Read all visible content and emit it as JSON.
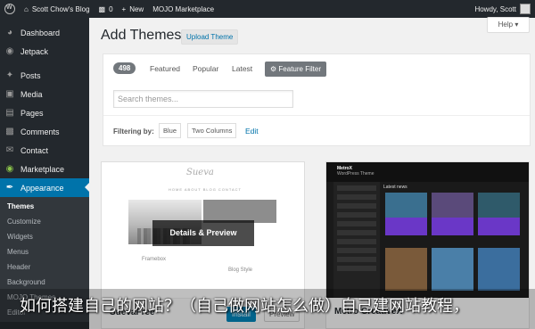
{
  "adminbar": {
    "site_name": "Scott Chow's Blog",
    "comments_count": "0",
    "new_label": "New",
    "marketplace_label": "MOJO Marketplace",
    "greeting": "Howdy, Scott"
  },
  "sidebar": {
    "items": [
      {
        "label": "Dashboard",
        "icon": "dashboard-icon"
      },
      {
        "label": "Jetpack",
        "icon": "jetpack-icon"
      },
      {
        "label": "Posts",
        "icon": "pin-icon"
      },
      {
        "label": "Media",
        "icon": "media-icon"
      },
      {
        "label": "Pages",
        "icon": "pages-icon"
      },
      {
        "label": "Comments",
        "icon": "comment-icon"
      },
      {
        "label": "Contact",
        "icon": "mail-icon"
      },
      {
        "label": "Marketplace",
        "icon": "marketplace-icon"
      },
      {
        "label": "Appearance",
        "icon": "paintbrush-icon"
      }
    ],
    "submenu": [
      "Themes",
      "Customize",
      "Widgets",
      "Menus",
      "Header",
      "Background",
      "MOJO Themes",
      "Editor"
    ]
  },
  "page": {
    "title": "Add Themes",
    "upload_label": "Upload Theme",
    "help_label": "Help ▾"
  },
  "filters": {
    "count": "498",
    "tabs": [
      "Featured",
      "Popular",
      "Latest"
    ],
    "feature_filter_label": "Feature Filter",
    "search_placeholder": "Search themes...",
    "filtering_label": "Filtering by:",
    "tags": [
      "Blue",
      "Two Columns"
    ],
    "edit_label": "Edit"
  },
  "themes": [
    {
      "name": "SuevaFree",
      "logo": "Sueva",
      "nav": "HOME  ABOUT  BLOG  CONTACT",
      "sub1": "Framebox",
      "sub2": "Blog Style",
      "overlay": "Details & Preview",
      "install_label": "Install",
      "preview_label": "Preview"
    },
    {
      "name": "Metro CreativeX",
      "logo": "MetroX",
      "logo_sub": "WordPress Theme",
      "latest_label": "Latest news"
    }
  ],
  "caption": "如何搭建自己的网站？（自己做网站怎么做）自己建网站教程，",
  "colors": {
    "admin_dark": "#23282d",
    "accent_blue": "#0073aa",
    "metro_purple": "#6a37c7"
  }
}
